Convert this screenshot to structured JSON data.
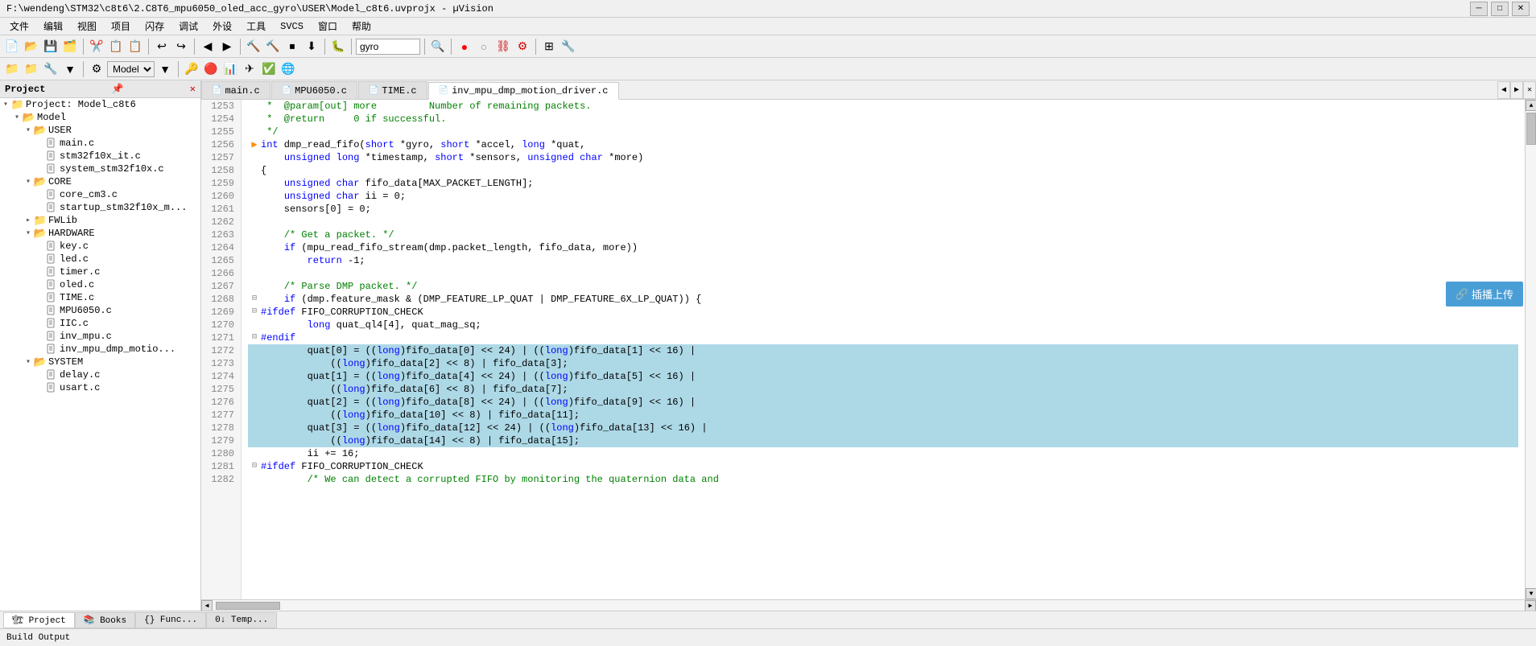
{
  "titleBar": {
    "title": "F:\\wendeng\\STM32\\c8t6\\2.C8T6_mpu6050_oled_acc_gyro\\USER\\Model_c8t6.uvprojx - µVision",
    "minimizeLabel": "─",
    "maximizeLabel": "□",
    "closeLabel": "✕"
  },
  "menuBar": {
    "items": [
      "文件",
      "编辑",
      "视图",
      "项目",
      "闪存",
      "调试",
      "外设",
      "工具",
      "SVCS",
      "窗口",
      "帮助"
    ]
  },
  "toolbar": {
    "searchPlaceholder": "gyro",
    "modelLabel": "Model"
  },
  "projectPanel": {
    "title": "Project",
    "tree": [
      {
        "id": "root",
        "label": "Project: Model_c8t6",
        "level": 0,
        "type": "project",
        "expanded": true
      },
      {
        "id": "model",
        "label": "Model",
        "level": 1,
        "type": "folder",
        "expanded": true
      },
      {
        "id": "user",
        "label": "USER",
        "level": 2,
        "type": "folder",
        "expanded": true
      },
      {
        "id": "main",
        "label": "main.c",
        "level": 3,
        "type": "file"
      },
      {
        "id": "stm32f10x_it",
        "label": "stm32f10x_it.c",
        "level": 3,
        "type": "file"
      },
      {
        "id": "system_stm32f10x",
        "label": "system_stm32f10x.c",
        "level": 3,
        "type": "file"
      },
      {
        "id": "core",
        "label": "CORE",
        "level": 2,
        "type": "folder",
        "expanded": true
      },
      {
        "id": "core_cm3",
        "label": "core_cm3.c",
        "level": 3,
        "type": "file"
      },
      {
        "id": "startup_stm32f10x_md",
        "label": "startup_stm32f10x_m...",
        "level": 3,
        "type": "file"
      },
      {
        "id": "fwlib",
        "label": "FWLib",
        "level": 2,
        "type": "folder",
        "expanded": false
      },
      {
        "id": "hardware",
        "label": "HARDWARE",
        "level": 2,
        "type": "folder",
        "expanded": true
      },
      {
        "id": "key",
        "label": "key.c",
        "level": 3,
        "type": "file"
      },
      {
        "id": "led",
        "label": "led.c",
        "level": 3,
        "type": "file"
      },
      {
        "id": "timer",
        "label": "timer.c",
        "level": 3,
        "type": "file"
      },
      {
        "id": "oled",
        "label": "oled.c",
        "level": 3,
        "type": "file"
      },
      {
        "id": "time",
        "label": "TIME.c",
        "level": 3,
        "type": "file"
      },
      {
        "id": "mpu6050",
        "label": "MPU6050.c",
        "level": 3,
        "type": "file"
      },
      {
        "id": "iic",
        "label": "IIC.c",
        "level": 3,
        "type": "file"
      },
      {
        "id": "inv_mpu",
        "label": "inv_mpu.c",
        "level": 3,
        "type": "file"
      },
      {
        "id": "inv_mpu_dmp",
        "label": "inv_mpu_dmp_motio...",
        "level": 3,
        "type": "file"
      },
      {
        "id": "system",
        "label": "SYSTEM",
        "level": 2,
        "type": "folder",
        "expanded": true
      },
      {
        "id": "delay",
        "label": "delay.c",
        "level": 3,
        "type": "file"
      },
      {
        "id": "usart",
        "label": "usart.c",
        "level": 3,
        "type": "file"
      }
    ]
  },
  "tabs": [
    {
      "id": "main_c",
      "label": "main.c",
      "active": false,
      "icon": "📄"
    },
    {
      "id": "mpu6050_c",
      "label": "MPU6050.c",
      "active": false,
      "icon": "📄"
    },
    {
      "id": "time_c",
      "label": "TIME.c",
      "active": false,
      "icon": "📄"
    },
    {
      "id": "inv_mpu_dmp_c",
      "label": "inv_mpu_dmp_motion_driver.c",
      "active": true,
      "icon": "📄"
    }
  ],
  "codeLines": [
    {
      "num": 1253,
      "indent": 2,
      "content": " *  @param[out] more         Number of remaining packets.",
      "highlight": false,
      "type": "comment"
    },
    {
      "num": 1254,
      "indent": 2,
      "content": " *  @return     0 if successful.",
      "highlight": false,
      "type": "comment"
    },
    {
      "num": 1255,
      "indent": 2,
      "content": " */",
      "highlight": false,
      "type": "comment"
    },
    {
      "num": 1256,
      "indent": 0,
      "content": "int dmp_read_fifo(short *gyro, short *accel, long *quat,",
      "highlight": false,
      "type": "code",
      "hasArrow": true
    },
    {
      "num": 1257,
      "indent": 0,
      "content": "    unsigned long *timestamp, short *sensors, unsigned char *more)",
      "highlight": false,
      "type": "code"
    },
    {
      "num": 1258,
      "indent": 0,
      "content": "{",
      "highlight": false,
      "type": "code"
    },
    {
      "num": 1259,
      "indent": 0,
      "content": "    unsigned char fifo_data[MAX_PACKET_LENGTH];",
      "highlight": false,
      "type": "code"
    },
    {
      "num": 1260,
      "indent": 0,
      "content": "    unsigned char ii = 0;",
      "highlight": false,
      "type": "code"
    },
    {
      "num": 1261,
      "indent": 0,
      "content": "    sensors[0] = 0;",
      "highlight": false,
      "type": "code"
    },
    {
      "num": 1262,
      "indent": 0,
      "content": "",
      "highlight": false,
      "type": "code"
    },
    {
      "num": 1263,
      "indent": 0,
      "content": "    /* Get a packet. */",
      "highlight": false,
      "type": "comment"
    },
    {
      "num": 1264,
      "indent": 0,
      "content": "    if (mpu_read_fifo_stream(dmp.packet_length, fifo_data, more))",
      "highlight": false,
      "type": "code"
    },
    {
      "num": 1265,
      "indent": 0,
      "content": "        return -1;",
      "highlight": false,
      "type": "code"
    },
    {
      "num": 1266,
      "indent": 0,
      "content": "",
      "highlight": false,
      "type": "code"
    },
    {
      "num": 1267,
      "indent": 0,
      "content": "    /* Parse DMP packet. */",
      "highlight": false,
      "type": "comment"
    },
    {
      "num": 1268,
      "indent": 0,
      "content": "    if (dmp.feature_mask & (DMP_FEATURE_LP_QUAT | DMP_FEATURE_6X_LP_QUAT)) {",
      "highlight": false,
      "type": "code",
      "hasCollapse": true
    },
    {
      "num": 1269,
      "indent": 0,
      "content": "#ifdef FIFO_CORRUPTION_CHECK",
      "highlight": false,
      "type": "preproc"
    },
    {
      "num": 1270,
      "indent": 0,
      "content": "        long quat_ql4[4], quat_mag_sq;",
      "highlight": false,
      "type": "code"
    },
    {
      "num": 1271,
      "indent": 0,
      "content": "#endif",
      "highlight": false,
      "type": "preproc"
    },
    {
      "num": 1272,
      "indent": 0,
      "content": "        quat[0] = ((long)fifo_data[0] << 24) | ((long)fifo_data[1] << 16) |",
      "highlight": true,
      "type": "code"
    },
    {
      "num": 1273,
      "indent": 0,
      "content": "            ((long)fifo_data[2] << 8) | fifo_data[3];",
      "highlight": true,
      "type": "code"
    },
    {
      "num": 1274,
      "indent": 0,
      "content": "        quat[1] = ((long)fifo_data[4] << 24) | ((long)fifo_data[5] << 16) |",
      "highlight": true,
      "type": "code"
    },
    {
      "num": 1275,
      "indent": 0,
      "content": "            ((long)fifo_data[6] << 8) | fifo_data[7];",
      "highlight": true,
      "type": "code"
    },
    {
      "num": 1276,
      "indent": 0,
      "content": "        quat[2] = ((long)fifo_data[8] << 24) | ((long)fifo_data[9] << 16) |",
      "highlight": true,
      "type": "code"
    },
    {
      "num": 1277,
      "indent": 0,
      "content": "            ((long)fifo_data[10] << 8) | fifo_data[11];",
      "highlight": true,
      "type": "code"
    },
    {
      "num": 1278,
      "indent": 0,
      "content": "        quat[3] = ((long)fifo_data[12] << 24) | ((long)fifo_data[13] << 16) |",
      "highlight": true,
      "type": "code"
    },
    {
      "num": 1279,
      "indent": 0,
      "content": "            ((long)fifo_data[14] << 8) | fifo_data[15];",
      "highlight": true,
      "type": "code"
    },
    {
      "num": 1280,
      "indent": 0,
      "content": "        ii += 16;",
      "highlight": false,
      "type": "code"
    },
    {
      "num": 1281,
      "indent": 0,
      "content": "#ifdef FIFO_CORRUPTION_CHECK",
      "highlight": false,
      "type": "preproc"
    },
    {
      "num": 1282,
      "indent": 0,
      "content": "        /* We can detect a corrupted FIFO by monitoring the quaternion data and",
      "highlight": false,
      "type": "comment"
    }
  ],
  "statusTabs": [
    {
      "label": "🏗 Project",
      "active": true
    },
    {
      "label": "📚 Books",
      "active": false
    },
    {
      "label": "{} Func...",
      "active": false
    },
    {
      "label": "0↓ Temp...",
      "active": false
    }
  ],
  "floatBtn": {
    "icon": "🔗",
    "label": "插播上传"
  },
  "statusBar": {
    "text": "Build Output"
  }
}
